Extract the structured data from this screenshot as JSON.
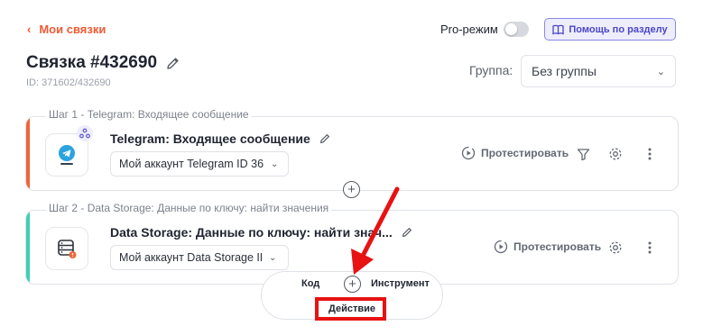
{
  "header": {
    "back_label": "Мои связки",
    "pro_mode_label": "Pro-режим",
    "pro_mode_on": false,
    "help_label": "Помощь по разделу",
    "title": "Связка #432690",
    "id_label": "ID: 371602/432690",
    "group_label": "Группа:",
    "group_value": "Без группы"
  },
  "steps": [
    {
      "legend": "Шаг 1 - Telegram: Входящее сообщение",
      "name": "Telegram: Входящее сообщение",
      "account": "Мой аккаунт Telegram ID 36",
      "test_label": "Протестировать",
      "accent_color": "#f0643a",
      "icon": "telegram-icon",
      "badge_icon": "webhook-icon"
    },
    {
      "legend": "Шаг 2 - Data Storage: Данные по ключу: найти значения",
      "name": "Data Storage: Данные по ключу: найти знач...",
      "account": "Мой аккаунт Data Storage ID",
      "test_label": "Протестировать",
      "accent_color": "#3fcfb3",
      "icon": "database-icon",
      "badge_icon": "warning-icon"
    }
  ],
  "add_menu": {
    "code_label": "Код",
    "tool_label": "Инструмент",
    "action_label": "Действие"
  },
  "annotations": {
    "highlight_color": "#e81212",
    "arrow_color": "#e81212"
  }
}
